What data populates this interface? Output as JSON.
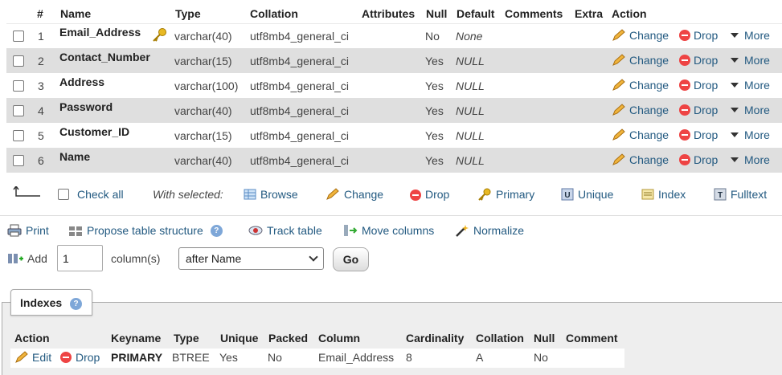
{
  "structure": {
    "headers": [
      "#",
      "Name",
      "Type",
      "Collation",
      "Attributes",
      "Null",
      "Default",
      "Comments",
      "Extra",
      "Action"
    ],
    "rows": [
      {
        "num": "1",
        "name": "Email_Address",
        "type": "varchar(40)",
        "collation": "utf8mb4_general_ci",
        "null": "No",
        "default": "None",
        "primary": true
      },
      {
        "num": "2",
        "name": "Contact_Number",
        "type": "varchar(15)",
        "collation": "utf8mb4_general_ci",
        "null": "Yes",
        "default": "NULL"
      },
      {
        "num": "3",
        "name": "Address",
        "type": "varchar(100)",
        "collation": "utf8mb4_general_ci",
        "null": "Yes",
        "default": "NULL"
      },
      {
        "num": "4",
        "name": "Password",
        "type": "varchar(40)",
        "collation": "utf8mb4_general_ci",
        "null": "Yes",
        "default": "NULL"
      },
      {
        "num": "5",
        "name": "Customer_ID",
        "type": "varchar(15)",
        "collation": "utf8mb4_general_ci",
        "null": "Yes",
        "default": "NULL"
      },
      {
        "num": "6",
        "name": "Name",
        "type": "varchar(40)",
        "collation": "utf8mb4_general_ci",
        "null": "Yes",
        "default": "NULL"
      }
    ],
    "actions": {
      "change": "Change",
      "drop": "Drop",
      "more": "More"
    }
  },
  "selection": {
    "check_all": "Check all",
    "with_selected": "With selected:",
    "browse": "Browse",
    "change": "Change",
    "drop": "Drop",
    "primary": "Primary",
    "unique": "Unique",
    "index": "Index",
    "fulltext": "Fulltext"
  },
  "toolbar": {
    "print": "Print",
    "propose": "Propose table structure",
    "track": "Track table",
    "move": "Move columns",
    "normalize": "Normalize"
  },
  "add_column": {
    "label": "Add",
    "count": "1",
    "unit": "column(s)",
    "position": "after Name",
    "go": "Go"
  },
  "indexes": {
    "legend": "Indexes",
    "headers": [
      "Action",
      "Keyname",
      "Type",
      "Unique",
      "Packed",
      "Column",
      "Cardinality",
      "Collation",
      "Null",
      "Comment"
    ],
    "row": {
      "edit": "Edit",
      "drop": "Drop",
      "keyname": "PRIMARY",
      "type": "BTREE",
      "unique": "Yes",
      "packed": "No",
      "column": "Email_Address",
      "cardinality": "8",
      "collation": "A",
      "null": "No",
      "comment": ""
    }
  },
  "colors": {
    "link": "#235a81",
    "row_alt": "#dfdfdf",
    "drop_red": "#e44",
    "key_gold": "#d4a017"
  }
}
